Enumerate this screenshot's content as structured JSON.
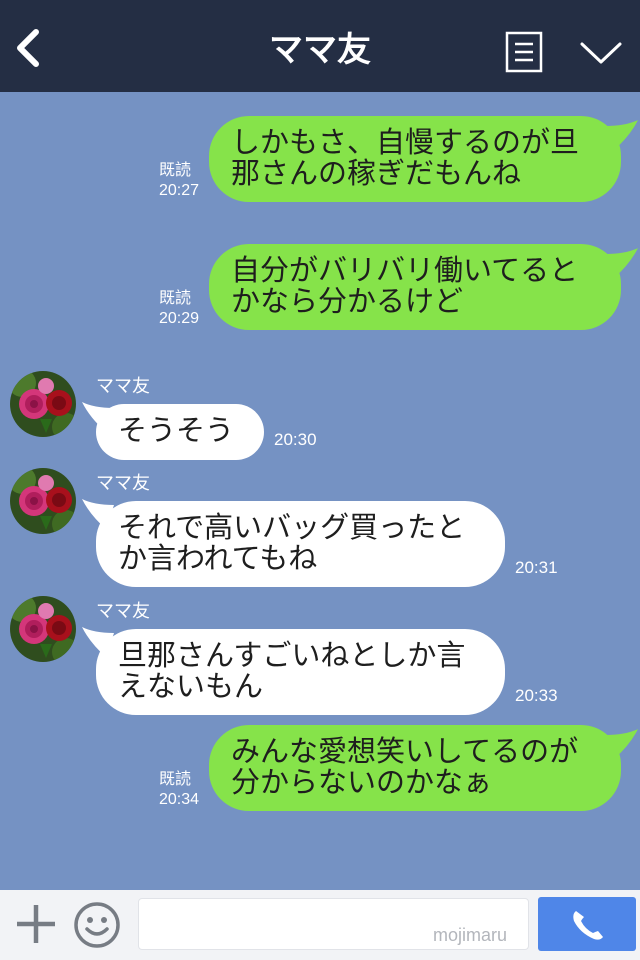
{
  "header": {
    "title": "ママ友"
  },
  "messages": [
    {
      "side": "mine",
      "lines": [
        "しかもさ、自慢するのが旦",
        "那さんの稼ぎだもんね"
      ],
      "read": "既読",
      "time": "20:27"
    },
    {
      "side": "mine",
      "lines": [
        "自分がバリバリ働いてると",
        "かなら分かるけど"
      ],
      "read": "既読",
      "time": "20:29"
    },
    {
      "side": "theirs",
      "sender": "ママ友",
      "lines": [
        "そうそう"
      ],
      "time": "20:30"
    },
    {
      "side": "theirs",
      "sender": "ママ友",
      "lines": [
        "それで高いバッグ買ったと",
        "か言われてもね"
      ],
      "time": "20:31"
    },
    {
      "side": "theirs",
      "sender": "ママ友",
      "lines": [
        "旦那さんすごいねとしか言",
        "えないもん"
      ],
      "time": "20:33"
    },
    {
      "side": "mine",
      "lines": [
        "みんな愛想笑いしてるのが",
        "分からないのかなぁ"
      ],
      "read": "既読",
      "time": "20:34"
    }
  ],
  "composer": {
    "input_value": "",
    "watermark": "mojimaru"
  },
  "colors": {
    "header_bg": "#242e44",
    "chat_bg": "#7592c3",
    "mine_bubble": "#86e34a",
    "theirs_bubble": "#ffffff",
    "call_button": "#4f86e8"
  },
  "icons": {
    "back": "chevron-left-icon",
    "menu": "menu-list-icon",
    "collapse": "chevron-down-icon",
    "plus": "plus-icon",
    "emoji": "smiley-icon",
    "call": "phone-icon"
  }
}
